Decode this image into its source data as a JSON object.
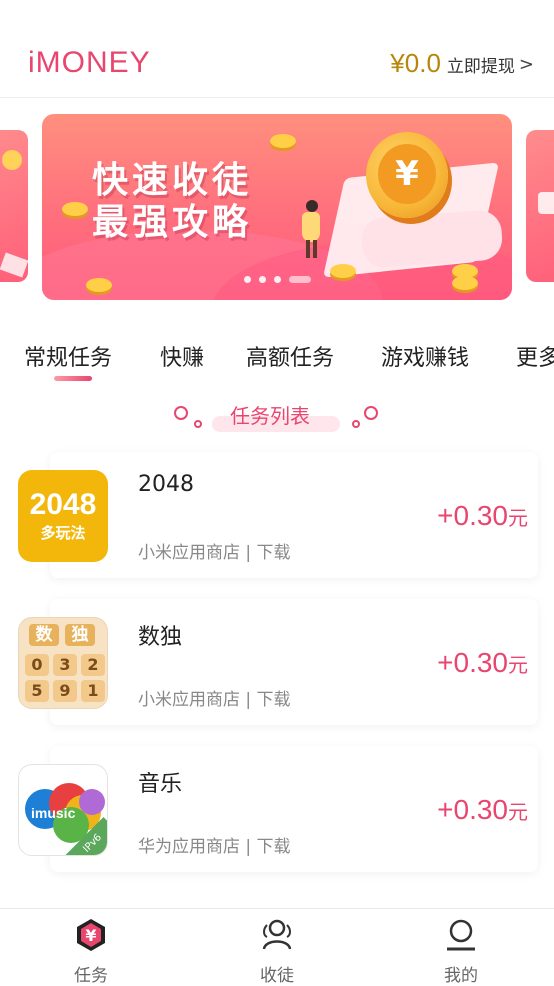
{
  "header": {
    "logo": "iMONEY",
    "balance": "¥0.0",
    "withdraw_label": "立即提现",
    "withdraw_chevron": ">"
  },
  "banner": {
    "line1": "快速收徒",
    "line2": "最强攻略",
    "coin_symbol": "¥",
    "slide_count": 4,
    "active_slide": 4
  },
  "tabs": [
    {
      "label": "常规任务",
      "active": true
    },
    {
      "label": "快赚",
      "active": false
    },
    {
      "label": "高额任务",
      "active": false
    },
    {
      "label": "游戏赚钱",
      "active": false
    },
    {
      "label": "更多",
      "active": false
    }
  ],
  "section_title": "任务列表",
  "tasks": [
    {
      "name": "2048",
      "meta": "小米应用商店 | 下载",
      "reward_value": "+0.30",
      "reward_unit": "元",
      "icon": {
        "type": "2048-icon",
        "text_big": "2048",
        "text_small": "多玩法"
      }
    },
    {
      "name": "数独",
      "meta": "小米应用商店 | 下载",
      "reward_value": "+0.30",
      "reward_unit": "元",
      "icon": {
        "type": "sudoku-icon",
        "title_chars": [
          "数",
          "独"
        ],
        "digits": [
          "0",
          "3",
          "2",
          "5",
          "9",
          "1"
        ]
      }
    },
    {
      "name": "音乐",
      "meta": "华为应用商店 | 下载",
      "reward_value": "+0.30",
      "reward_unit": "元",
      "icon": {
        "type": "music-icon",
        "label": "imusic",
        "corner": "IPv6"
      }
    }
  ],
  "bottom_nav": [
    {
      "label": "任务",
      "icon": "yuan-hexagon-icon",
      "active": true
    },
    {
      "label": "收徒",
      "icon": "users-icon",
      "active": false
    },
    {
      "label": "我的",
      "icon": "user-icon",
      "active": false
    }
  ],
  "colors": {
    "brand": "#e8466f",
    "balance": "#b8860b",
    "muted": "#888888"
  }
}
